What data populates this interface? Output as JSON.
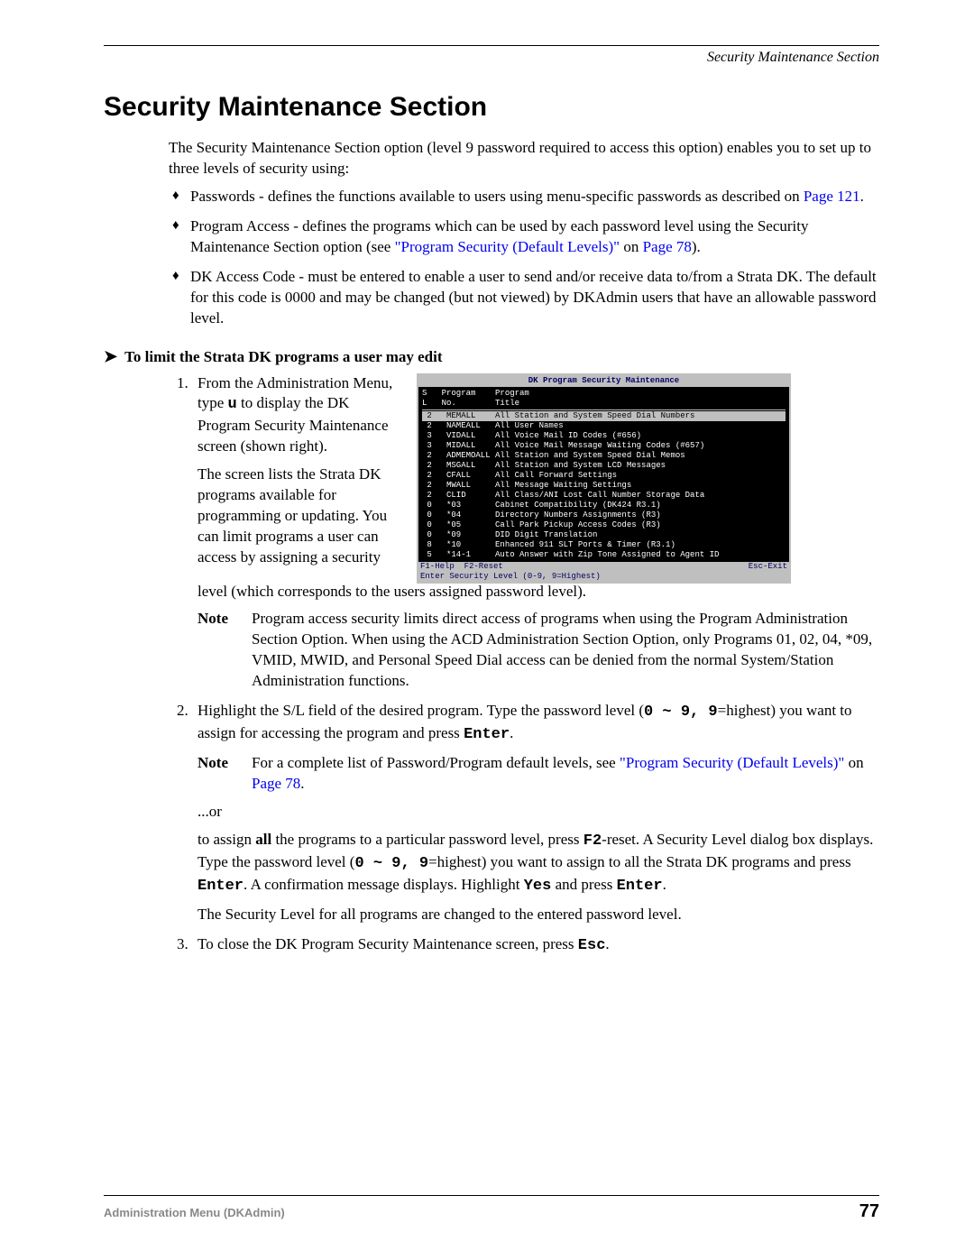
{
  "header_label": "Security Maintenance Section",
  "title": "Security Maintenance Section",
  "intro": "The Security Maintenance Section option (level 9 password required to access this option) enables you to set up to three levels of security using:",
  "bul1_a": "Passwords - defines the functions available to users using menu-specific passwords as described on ",
  "bul1_link": "Page 121",
  "bul1_b": ".",
  "bul2_a": "Program Access - defines the programs which can be used by each password level using the Security Maintenance Section option (see ",
  "bul2_link1": "\"Program Security (Default Levels)\"",
  "bul2_b": " on ",
  "bul2_link2": "Page 78",
  "bul2_c": ").",
  "bul3": "DK Access Code - must be entered to enable a user to send and/or receive data to/from a Strata DK. The default for this code is 0000 and may be changed (but not viewed) by DKAdmin users that have an allowable password level.",
  "proc_heading": "To limit the Strata DK programs a user may edit",
  "step1_p1a": "From the Administration Menu, type ",
  "step1_key": "u",
  "step1_p1b": " to display the DK Program Security Maintenance screen (shown right).",
  "step1_p2": "The screen lists the Strata DK programs available for programming or updating. You can limit programs a user can access by assigning a security level (which corresponds to the users assigned password level).",
  "note1": "Program access security limits direct access of programs when using the Program Administration Section Option. When using the ACD Administration Section Option, only Programs 01, 02, 04, *09, VMID, MWID, and Personal Speed Dial access can be denied from the normal System/Station Administration functions.",
  "step2_a": "Highlight the S/L field of the desired program. Type the password level (",
  "step2_range": "0 ~ 9, 9",
  "step2_b": "=highest) you want to assign for accessing the program and press ",
  "step2_enter": "Enter",
  "step2_c": ".",
  "note2_a": "For a complete list of Password/Program default levels, see ",
  "note2_link1": "\"Program Security (Default Levels)\"",
  "note2_b": " on ",
  "note2_link2": "Page 78",
  "note2_c": ".",
  "or_text": "...or",
  "assign_a": "to assign ",
  "assign_all": "all",
  "assign_b": " the programs to a particular password level, press ",
  "assign_f2": "F2",
  "assign_c": "-reset. A Security Level dialog box displays. Type the password level (",
  "assign_range": "0 ~ 9, 9",
  "assign_d": "=highest) you want to assign to all the Strata DK programs and press ",
  "assign_enter1": "Enter",
  "assign_e": ". A confirmation message displays. Highlight ",
  "assign_yes": "Yes",
  "assign_f": " and press ",
  "assign_enter2": "Enter",
  "assign_g": ".",
  "assign_conf": "The Security Level for all programs are changed to the entered password level.",
  "step3_a": "To close the DK Program Security Maintenance screen, press ",
  "step3_esc": "Esc",
  "step3_b": ".",
  "note_label": "Note",
  "footer_left": "Administration Menu (DKAdmin)",
  "footer_page": "77",
  "dos": {
    "title": "DK Program Security Maintenance",
    "head1": "S   Program    Program",
    "head2": "L   No.        Title",
    "sel": " 2   MEMALL    All Station and System Speed Dial Numbers",
    "rows": [
      " 2   NAMEALL   All User Names",
      " 3   VIDALL    All Voice Mail ID Codes (#656)",
      " 3   MIDALL    All Voice Mail Message Waiting Codes (#657)",
      " 2   ADMEMOALL All Station and System Speed Dial Memos",
      " 2   MSGALL    All Station and System LCD Messages",
      " 2   CFALL     All Call Forward Settings",
      " 2   MWALL     All Message Waiting Settings",
      " 2   CLID      All Class/ANI Lost Call Number Storage Data",
      " 0   *03       Cabinet Compatibility (DK424 R3.1)",
      " 0   *04       Directory Numbers Assignments (R3)",
      " 0   *05       Call Park Pickup Access Codes (R3)",
      " 0   *09       DID Digit Translation",
      " 8   *10       Enhanced 911 SLT Ports & Timer (R3.1)",
      " 5   *14-1     Auto Answer with Zip Tone Assigned to Agent ID"
    ],
    "foot_left": "F1-Help  F2-Reset",
    "foot_right": "Esc-Exit",
    "foot_bottom": "Enter Security Level (0-9, 9=Highest)"
  }
}
